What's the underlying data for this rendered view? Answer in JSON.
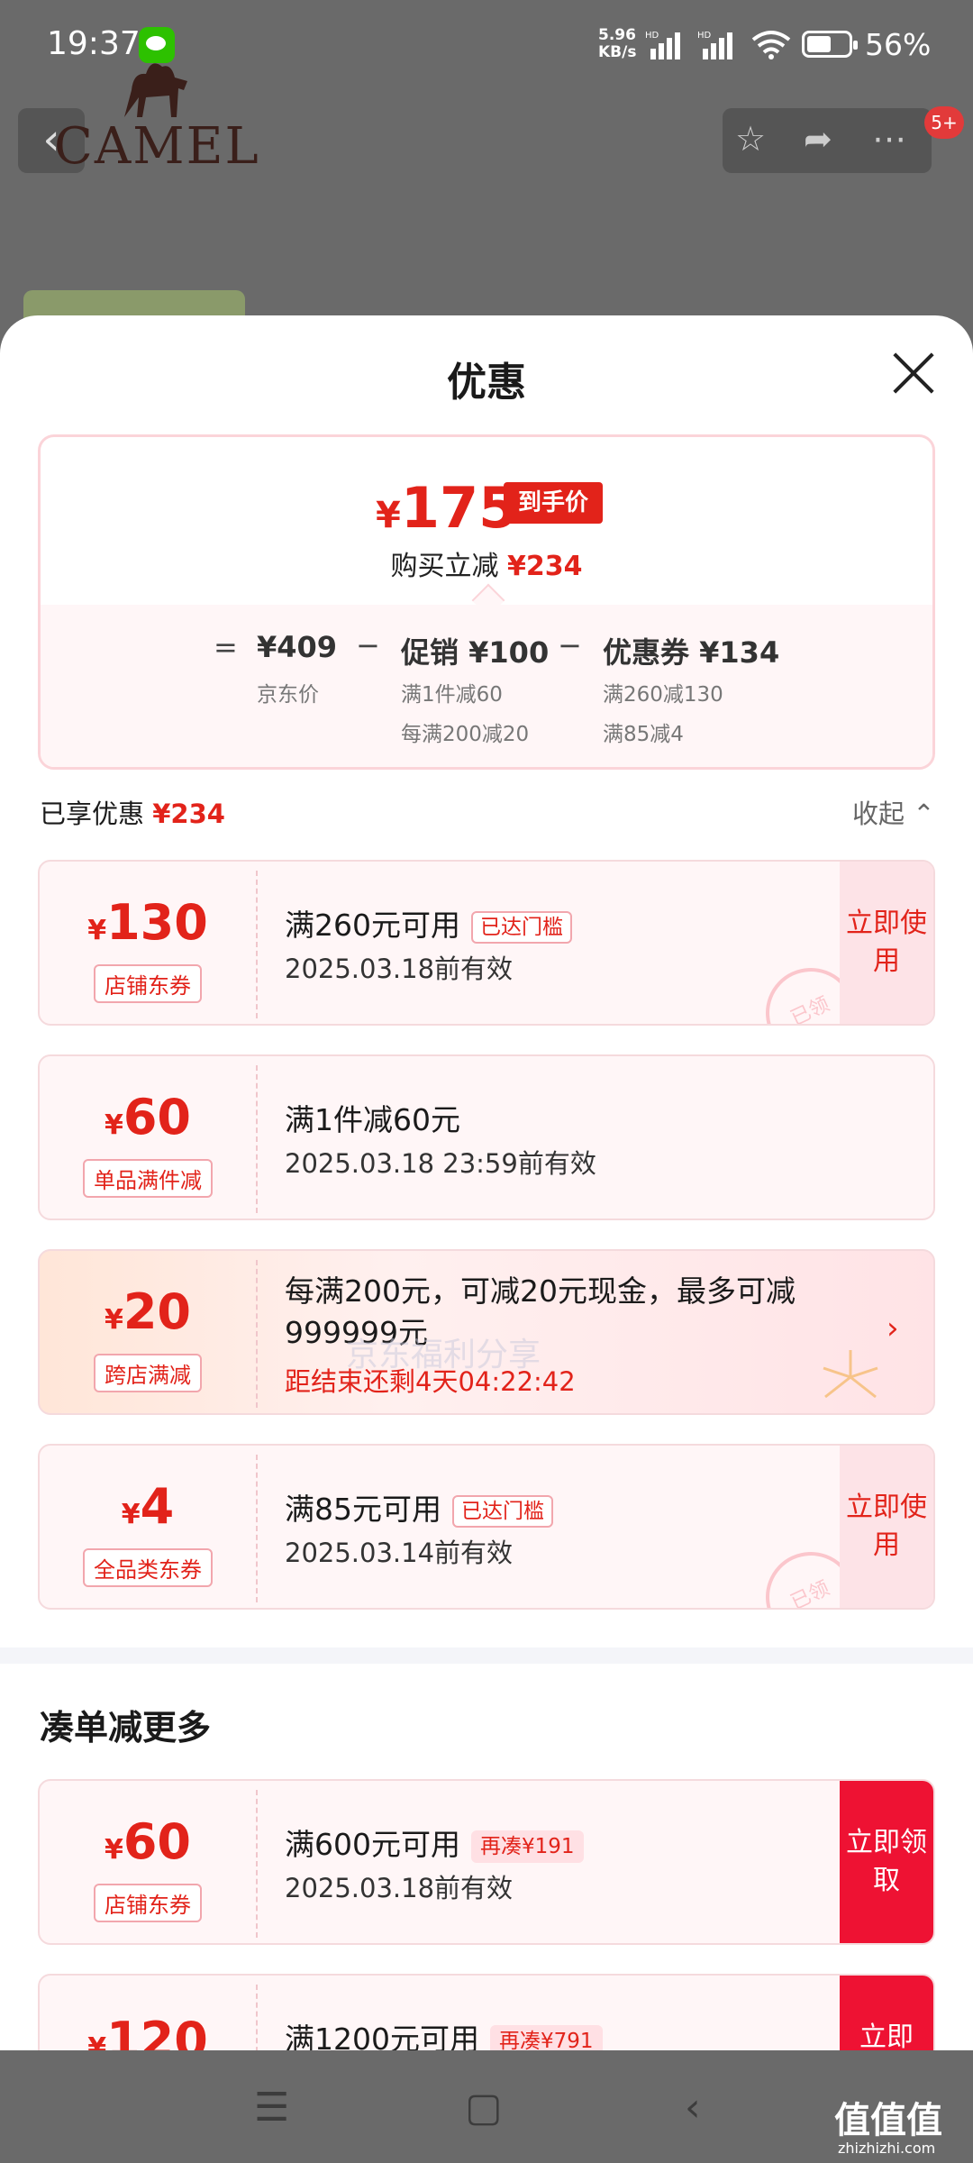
{
  "status_bar": {
    "time": "19:37",
    "net_speed": "5.96",
    "net_unit": "KB/s",
    "sig1": "HD",
    "sig2": "HD",
    "battery": "56%"
  },
  "background": {
    "brand": "CAMEL",
    "badge": "5+"
  },
  "sheet": {
    "title": "优惠",
    "summary": {
      "final_price_symbol": "¥",
      "final_price": "175",
      "final_tag": "到手价",
      "instant_label": "购买立减",
      "instant_value": "¥234",
      "eq": "=",
      "jd_price": "¥409",
      "jd_price_label": "京东价",
      "minus1": "−",
      "promo": "促销 ¥100",
      "promo_d1": "满1件减60",
      "promo_d2": "每满200减20",
      "minus2": "−",
      "coupon": "优惠券 ¥134",
      "coupon_d1": "满260减130",
      "coupon_d2": "满85减4"
    },
    "enjoyed_label": "已享优惠",
    "enjoyed_value": "¥234",
    "collapse_label": "收起 ⌃",
    "cards": [
      {
        "symbol": "¥",
        "amount": "130",
        "tag": "店铺东券",
        "title": "满260元可用",
        "pill": "已达门槛",
        "valid": "2025.03.18前有效",
        "action": "立即使用",
        "stamp": "已领"
      },
      {
        "symbol": "¥",
        "amount": "60",
        "tag": "单品满件减",
        "title": "满1件减60元",
        "valid": "2025.03.18 23:59前有效"
      },
      {
        "symbol": "¥",
        "amount": "20",
        "tag": "跨店满减",
        "text": "每满200元，可减20元现金，最多可减999999元",
        "countdown": "距结束还剩4天04:22:42",
        "chevron": "›"
      },
      {
        "symbol": "¥",
        "amount": "4",
        "tag": "全品类东券",
        "title": "满85元可用",
        "pill": "已达门槛",
        "valid": "2025.03.14前有效",
        "action": "立即使用",
        "stamp": "已领"
      }
    ],
    "more_title": "凑单减更多",
    "more_cards": [
      {
        "symbol": "¥",
        "amount": "60",
        "tag": "店铺东券",
        "title": "满600元可用",
        "pill": "再凑¥191",
        "valid": "2025.03.18前有效",
        "action": "立即领取"
      },
      {
        "symbol": "¥",
        "amount": "120",
        "title": "满1200元可用",
        "pill": "再凑¥791",
        "action": "立即"
      }
    ],
    "watermark": "京东福利分享"
  },
  "navbar": {
    "menu": "☰",
    "home": "▢",
    "back": "‹"
  },
  "site": {
    "logo": "值值值",
    "url": "zhizhizhi.com"
  },
  "colors": {
    "accent": "#e2231a",
    "card_bg": "#fff6f7",
    "action_solid": "#ee1233"
  }
}
